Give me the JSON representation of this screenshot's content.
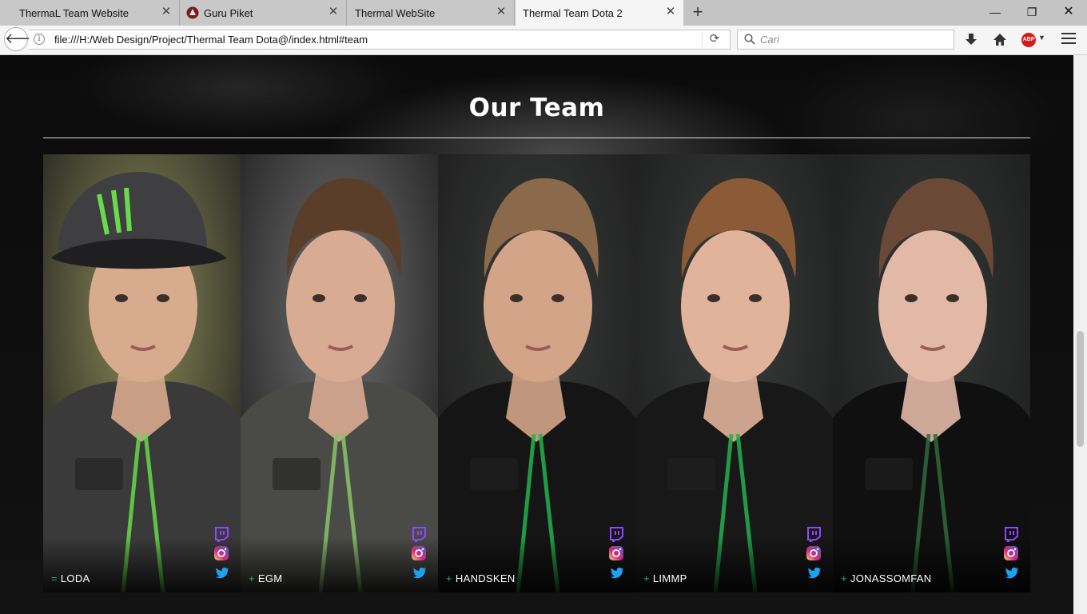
{
  "browser": {
    "tabs": [
      {
        "label": "ThermaL Team Website",
        "active": false,
        "icon": null
      },
      {
        "label": "Guru Piket",
        "active": false,
        "icon": "guru-piket-favicon-icon"
      },
      {
        "label": "Thermal WebSite",
        "active": false,
        "icon": null
      },
      {
        "label": "Thermal Team Dota 2",
        "active": true,
        "icon": null
      }
    ],
    "tab_close_glyph": "✕",
    "new_tab_glyph": "+",
    "window_buttons": {
      "minimize": "—",
      "restore": "❐",
      "close": "✕"
    },
    "url": "file:///H:/Web Design/Project/Thermal Team Dota@/index.html#team",
    "search_placeholder": "Cari",
    "abp_label": "ABP",
    "icons": {
      "back": "arrow-left-icon",
      "info": "info-icon",
      "reload": "reload-icon",
      "search": "search-icon",
      "download": "download-icon",
      "home": "home-icon",
      "menu": "hamburger-menu-icon"
    }
  },
  "page": {
    "section_title": "Our Team",
    "players": [
      {
        "prefix": "=",
        "name": "LODA",
        "jacket": "#3a3a3a",
        "bg": "#8d8c5a",
        "accent": "#6ad94c",
        "skin": "#d8ab8e",
        "hair": "#b48b5a",
        "cap": true
      },
      {
        "prefix": "+",
        "name": "EGM",
        "jacket": "#4a4a46",
        "bg": "#707070",
        "accent": "#8ac36a",
        "skin": "#d9ab92",
        "hair": "#5a3e2a",
        "cap": false
      },
      {
        "prefix": "+",
        "name": "HANDSKEN",
        "jacket": "#151515",
        "bg": "#3a3d3b",
        "accent": "#22b24c",
        "skin": "#d3a487",
        "hair": "#8a6a4a",
        "cap": false
      },
      {
        "prefix": "+",
        "name": "LIMMP",
        "jacket": "#181818",
        "bg": "#3b3d3d",
        "accent": "#22b24c",
        "skin": "#e0b39a",
        "hair": "#8a5b36",
        "cap": false
      },
      {
        "prefix": "+",
        "name": "JONASSOMFAN",
        "jacket": "#101010",
        "bg": "#363838",
        "accent": "#2f6a3a",
        "skin": "#e2b8a6",
        "hair": "#6a4a36",
        "cap": false
      }
    ],
    "social_icons": [
      "twitch-icon",
      "instagram-icon",
      "twitter-icon"
    ],
    "colors": {
      "twitch": "#9146ff",
      "instagram": "#e1306c",
      "twitter": "#1da1f2",
      "plus": "#29b46b"
    }
  }
}
